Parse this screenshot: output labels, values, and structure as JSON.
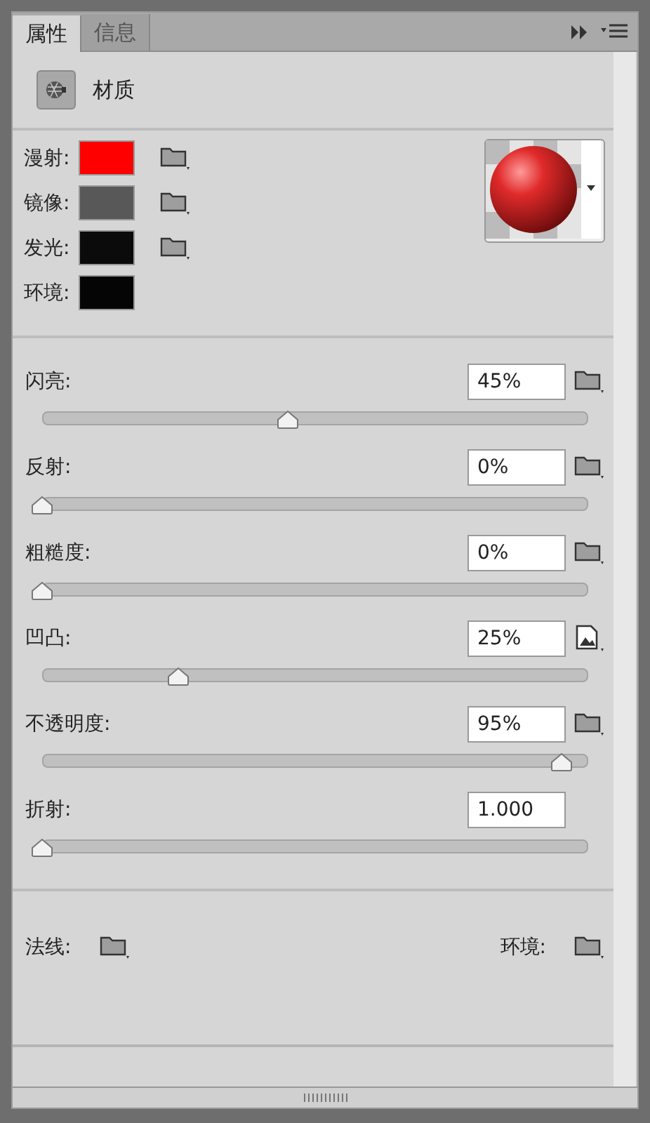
{
  "tabs": [
    {
      "label": "属性",
      "selected": true
    },
    {
      "label": "信息",
      "selected": false
    }
  ],
  "header": {
    "title": "材质"
  },
  "colors": [
    {
      "label": "漫射:",
      "color": "#fe0000",
      "texture_button": true
    },
    {
      "label": "镜像:",
      "color": "#585858",
      "texture_button": true
    },
    {
      "label": "发光:",
      "color": "#0b0b0b",
      "texture_button": true
    },
    {
      "label": "环境:",
      "color": "#050505",
      "texture_button": false
    }
  ],
  "sliders": [
    {
      "label": "闪亮:",
      "value": "45%",
      "level": 0.45,
      "texture_button": true,
      "texture_loaded": false
    },
    {
      "label": "反射:",
      "value": "0%",
      "level": 0,
      "texture_button": true,
      "texture_loaded": false
    },
    {
      "label": "粗糙度:",
      "value": "0%",
      "level": 0,
      "texture_button": true,
      "texture_loaded": false
    },
    {
      "label": "凹凸:",
      "value": "25%",
      "level": 0.25,
      "texture_button": true,
      "texture_loaded": true
    },
    {
      "label": "不透明度:",
      "value": "95%",
      "level": 0.95,
      "texture_button": true,
      "texture_loaded": false
    },
    {
      "label": "折射:",
      "value": "1.000",
      "level": 0,
      "texture_button": false,
      "texture_loaded": false
    }
  ],
  "maps": [
    {
      "label": "法线:",
      "texture_button": true
    },
    {
      "label": "环境:",
      "texture_button": true
    }
  ]
}
